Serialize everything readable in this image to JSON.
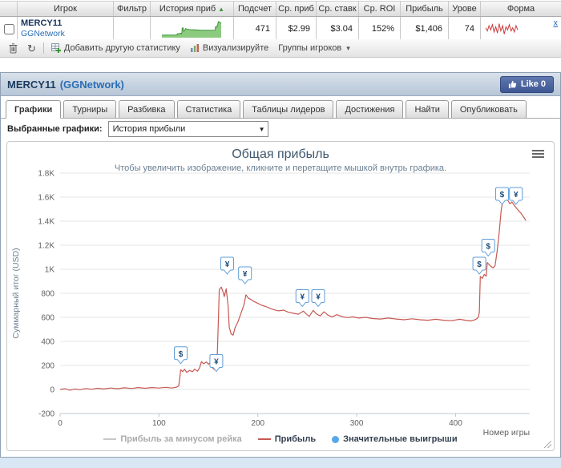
{
  "colors": {
    "profit_line": "#c65953",
    "rake_line": "#c8c8c8",
    "marker_border": "#5e9dd8",
    "marker_text": "#1c4b79",
    "spark_fill": "#8ccb7f",
    "spark_stroke": "#3f9639",
    "form_line": "#cc3b3b",
    "grid": "#e4e4e4",
    "axis_text": "#606060",
    "win_dot": "#58a8e8"
  },
  "results_table": {
    "columns": [
      "Игрок",
      "Фильтр",
      "История приб",
      "Подсчет",
      "Ср. приб",
      "Ср. ставк",
      "Ср. ROI",
      "Прибыль",
      "Урове",
      "Форма"
    ],
    "row": {
      "player": "MERCY11",
      "network": "GGNetwork",
      "count": "471",
      "avg_profit": "$2.99",
      "avg_stake": "$3.04",
      "avg_roi": "152%",
      "profit": "$1,406",
      "level": "74",
      "remove_label": "x"
    }
  },
  "toolbar": {
    "add_stat": "Добавить другую статистику",
    "visualize": "Визуализируйте",
    "groups": "Группы игроков"
  },
  "panel": {
    "player": "MERCY11",
    "network": "(GGNetwork)",
    "like_label": "Like 0",
    "tabs": [
      "Графики",
      "Турниры",
      "Разбивка",
      "Статистика",
      "Таблицы лидеров",
      "Достижения",
      "Найти",
      "Опубликовать"
    ],
    "selected_charts_label": "Выбранные графики:",
    "selected_chart_value": "История прибыли"
  },
  "chart_data": {
    "type": "line",
    "title": "Общая прибыль",
    "subtitle": "Чтобы увеличить изображение, кликните и перетащите мышкой внутрь графика.",
    "xlabel": "Номер игры",
    "ylabel": "Суммарный итог (USD)",
    "xlim": [
      0,
      475
    ],
    "ylim": [
      -200,
      1800
    ],
    "x_ticks": [
      0,
      100,
      200,
      300,
      400
    ],
    "y_ticks": [
      -200,
      0,
      200,
      400,
      600,
      800,
      1000,
      1200,
      1400,
      1600,
      1800
    ],
    "y_tick_labels": [
      "-200",
      "0",
      "200",
      "400",
      "600",
      "800",
      "1K",
      "1.2K",
      "1.4K",
      "1.6K",
      "1.8K"
    ],
    "grid": true,
    "legend_position": "bottom",
    "legend": [
      {
        "label": "Прибыль за минусом рейка",
        "type": "line",
        "color": "#c8c8c8",
        "disabled": true
      },
      {
        "label": "Прибыль",
        "type": "line",
        "color": "#c65953",
        "disabled": false
      },
      {
        "label": "Значительные выигрыши",
        "type": "marker",
        "color": "#58a8e8",
        "disabled": false
      }
    ],
    "series": [
      {
        "name": "Прибыль",
        "color": "#c65953",
        "points": [
          [
            0,
            0
          ],
          [
            5,
            6
          ],
          [
            10,
            -6
          ],
          [
            15,
            4
          ],
          [
            20,
            -2
          ],
          [
            26,
            8
          ],
          [
            32,
            2
          ],
          [
            38,
            10
          ],
          [
            44,
            4
          ],
          [
            51,
            12
          ],
          [
            58,
            6
          ],
          [
            65,
            14
          ],
          [
            72,
            8
          ],
          [
            79,
            16
          ],
          [
            86,
            10
          ],
          [
            93,
            16
          ],
          [
            100,
            12
          ],
          [
            107,
            18
          ],
          [
            113,
            12
          ],
          [
            118,
            20
          ],
          [
            120,
            30
          ],
          [
            121,
            95
          ],
          [
            122,
            165
          ],
          [
            124,
            148
          ],
          [
            126,
            168
          ],
          [
            128,
            142
          ],
          [
            131,
            158
          ],
          [
            134,
            148
          ],
          [
            136,
            168
          ],
          [
            139,
            152
          ],
          [
            141,
            178
          ],
          [
            143,
            232
          ],
          [
            145,
            214
          ],
          [
            148,
            228
          ],
          [
            150,
            210
          ],
          [
            152,
            224
          ],
          [
            154,
            182
          ],
          [
            156,
            166
          ],
          [
            157,
            240
          ],
          [
            159,
            300
          ],
          [
            160,
            560
          ],
          [
            161,
            830
          ],
          [
            163,
            852
          ],
          [
            165,
            806
          ],
          [
            166,
            772
          ],
          [
            168,
            838
          ],
          [
            170,
            690
          ],
          [
            171,
            520
          ],
          [
            173,
            462
          ],
          [
            175,
            452
          ],
          [
            177,
            516
          ],
          [
            180,
            566
          ],
          [
            183,
            636
          ],
          [
            186,
            706
          ],
          [
            188,
            788
          ],
          [
            190,
            762
          ],
          [
            193,
            748
          ],
          [
            196,
            732
          ],
          [
            200,
            716
          ],
          [
            204,
            700
          ],
          [
            208,
            690
          ],
          [
            212,
            676
          ],
          [
            216,
            664
          ],
          [
            221,
            654
          ],
          [
            226,
            660
          ],
          [
            231,
            642
          ],
          [
            236,
            634
          ],
          [
            241,
            626
          ],
          [
            246,
            652
          ],
          [
            249,
            628
          ],
          [
            252,
            608
          ],
          [
            256,
            658
          ],
          [
            259,
            630
          ],
          [
            263,
            612
          ],
          [
            267,
            646
          ],
          [
            271,
            618
          ],
          [
            275,
            604
          ],
          [
            280,
            622
          ],
          [
            285,
            606
          ],
          [
            290,
            598
          ],
          [
            296,
            604
          ],
          [
            302,
            594
          ],
          [
            309,
            600
          ],
          [
            316,
            590
          ],
          [
            324,
            586
          ],
          [
            332,
            594
          ],
          [
            340,
            586
          ],
          [
            348,
            580
          ],
          [
            356,
            588
          ],
          [
            364,
            580
          ],
          [
            372,
            576
          ],
          [
            380,
            584
          ],
          [
            388,
            576
          ],
          [
            396,
            572
          ],
          [
            404,
            584
          ],
          [
            410,
            576
          ],
          [
            415,
            570
          ],
          [
            419,
            578
          ],
          [
            421,
            586
          ],
          [
            423,
            600
          ],
          [
            424,
            640
          ],
          [
            425,
            940
          ],
          [
            427,
            924
          ],
          [
            429,
            958
          ],
          [
            431,
            942
          ],
          [
            432,
            1056
          ],
          [
            434,
            1038
          ],
          [
            436,
            1022
          ],
          [
            438,
            1012
          ],
          [
            440,
            1032
          ],
          [
            442,
            1150
          ],
          [
            444,
            1300
          ],
          [
            446,
            1480
          ],
          [
            448,
            1592
          ],
          [
            450,
            1618
          ],
          [
            452,
            1584
          ],
          [
            455,
            1545
          ],
          [
            457,
            1560
          ],
          [
            460,
            1524
          ],
          [
            463,
            1494
          ],
          [
            466,
            1468
          ],
          [
            468,
            1444
          ],
          [
            470,
            1420
          ],
          [
            471,
            1406
          ]
        ]
      }
    ],
    "significant_wins": [
      {
        "symbol": "$",
        "game": 122,
        "y": 215
      },
      {
        "symbol": "¥",
        "game": 158,
        "y": 150
      },
      {
        "symbol": "¥",
        "game": 169,
        "y": 960
      },
      {
        "symbol": "¥",
        "game": 187,
        "y": 880
      },
      {
        "symbol": "¥",
        "game": 245,
        "y": 690
      },
      {
        "symbol": "¥",
        "game": 261,
        "y": 690
      },
      {
        "symbol": "$",
        "game": 424,
        "y": 960
      },
      {
        "symbol": "$",
        "game": 433,
        "y": 1110
      },
      {
        "symbol": "$",
        "game": 447,
        "y": 1540
      },
      {
        "symbol": "¥",
        "game": 461,
        "y": 1540
      }
    ]
  },
  "form_spark": [
    1,
    -2,
    3,
    -1,
    4,
    -3,
    2,
    -4,
    5,
    -2,
    3,
    -5,
    2,
    -1,
    4,
    -2,
    1,
    -3,
    3,
    -1
  ]
}
